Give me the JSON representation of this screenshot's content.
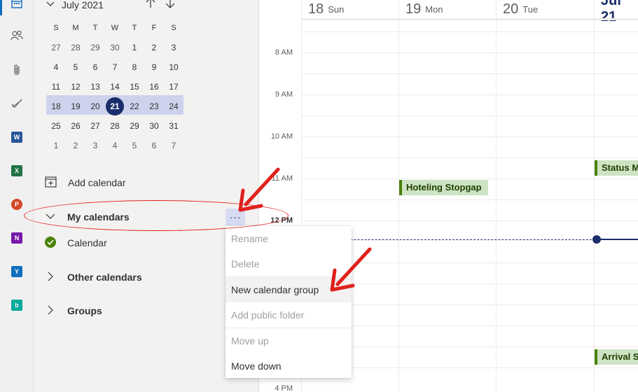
{
  "mini_calendar": {
    "month_label": "July 2021",
    "days_of_week": [
      "S",
      "M",
      "T",
      "W",
      "T",
      "F",
      "S"
    ],
    "weeks": [
      [
        "27",
        "28",
        "29",
        "30",
        "1",
        "2",
        "3"
      ],
      [
        "4",
        "5",
        "6",
        "7",
        "8",
        "9",
        "10"
      ],
      [
        "11",
        "12",
        "13",
        "14",
        "15",
        "16",
        "17"
      ],
      [
        "18",
        "19",
        "20",
        "21",
        "22",
        "23",
        "24"
      ],
      [
        "25",
        "26",
        "27",
        "28",
        "29",
        "30",
        "31"
      ],
      [
        "1",
        "2",
        "3",
        "4",
        "5",
        "6",
        "7"
      ]
    ],
    "selected_day": "21"
  },
  "sidebar": {
    "add_calendar": "Add calendar",
    "my_calendars": "My calendars",
    "more_label": "···",
    "calendar_item": "Calendar",
    "other_calendars": "Other calendars",
    "groups": "Groups"
  },
  "context_menu": {
    "items": [
      "Rename",
      "Delete",
      "New calendar group",
      "Add public folder",
      "Move up",
      "Move down"
    ]
  },
  "grid": {
    "days": [
      {
        "num": "18",
        "name": "Sun"
      },
      {
        "num": "19",
        "name": "Mon"
      },
      {
        "num": "20",
        "name": "Tue"
      },
      {
        "num": "Jul 21",
        "name": ""
      }
    ],
    "hours": [
      "8 AM",
      "9 AM",
      "10 AM",
      "11 AM",
      "12 PM",
      "4 PM"
    ],
    "events": [
      {
        "title": "Hoteling Stopgap"
      },
      {
        "title": "Status M"
      },
      {
        "title": "Arrival S"
      }
    ]
  },
  "colors": {
    "accent": "#1b2e6b",
    "week_highlight": "#cdd3ec",
    "event_fill": "#cde3c3",
    "event_border": "#498205",
    "annotation_red": "#e0211c"
  }
}
